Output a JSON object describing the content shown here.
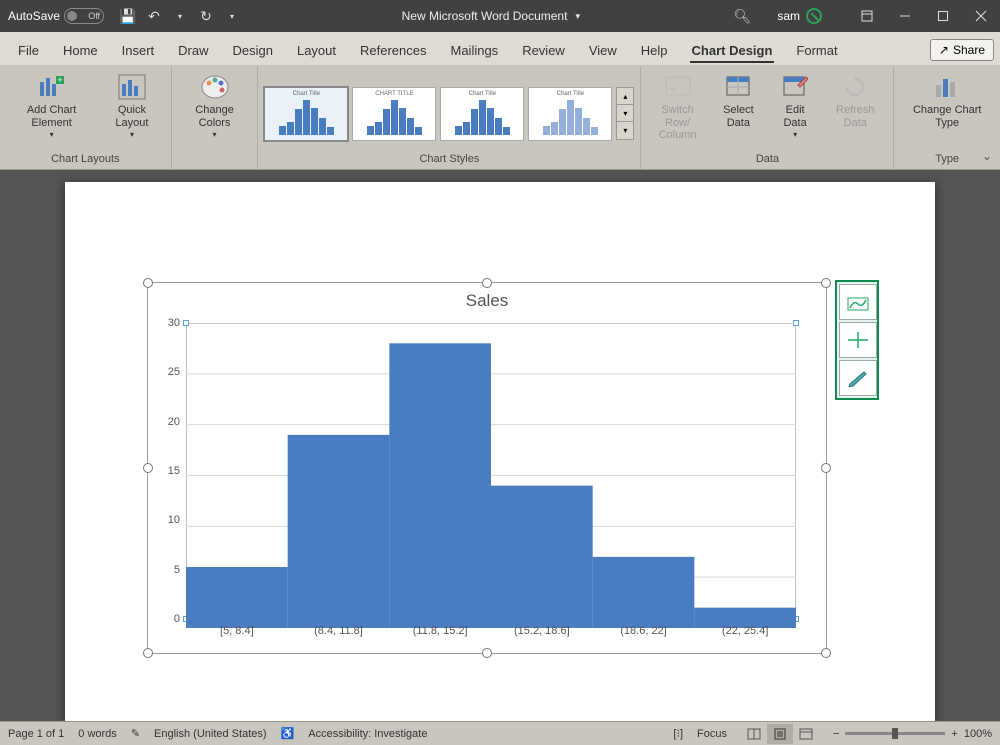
{
  "titlebar": {
    "autosave_label": "AutoSave",
    "autosave_state": "Off",
    "doc_title": "New Microsoft Word Document",
    "username": "sam"
  },
  "menus": {
    "file": "File",
    "home": "Home",
    "insert": "Insert",
    "draw": "Draw",
    "design": "Design",
    "layout": "Layout",
    "references": "References",
    "mailings": "Mailings",
    "review": "Review",
    "view": "View",
    "help": "Help",
    "chart_design": "Chart Design",
    "format": "Format",
    "share": "Share"
  },
  "ribbon": {
    "group_chart_layouts": "Chart Layouts",
    "group_chart_styles": "Chart Styles",
    "group_data": "Data",
    "group_type": "Type",
    "add_chart_element": "Add Chart Element",
    "quick_layout": "Quick Layout",
    "change_colors": "Change Colors",
    "switch_row_col": "Switch Row/ Column",
    "select_data": "Select Data",
    "edit_data": "Edit Data",
    "refresh_data": "Refresh Data",
    "change_chart_type": "Change Chart Type",
    "thumbs": [
      "Chart Title",
      "CHART TITLE",
      "Chart Title",
      "Chart Title"
    ]
  },
  "chart_data": {
    "type": "bar",
    "title": "Sales",
    "categories": [
      "[5, 8.4]",
      "(8.4, 11.8]",
      "(11.8, 15.2]",
      "(15.2, 18.6]",
      "(18.6, 22]",
      "(22, 25.4]"
    ],
    "values": [
      6,
      19,
      28,
      14,
      7,
      2
    ],
    "ylim": [
      0,
      30
    ],
    "yticks": [
      0,
      5,
      10,
      15,
      20,
      25,
      30
    ],
    "xlabel": "",
    "ylabel": ""
  },
  "statusbar": {
    "page": "Page 1 of 1",
    "words": "0 words",
    "language": "English (United States)",
    "accessibility": "Accessibility: Investigate",
    "focus": "Focus",
    "zoom": "100%"
  }
}
